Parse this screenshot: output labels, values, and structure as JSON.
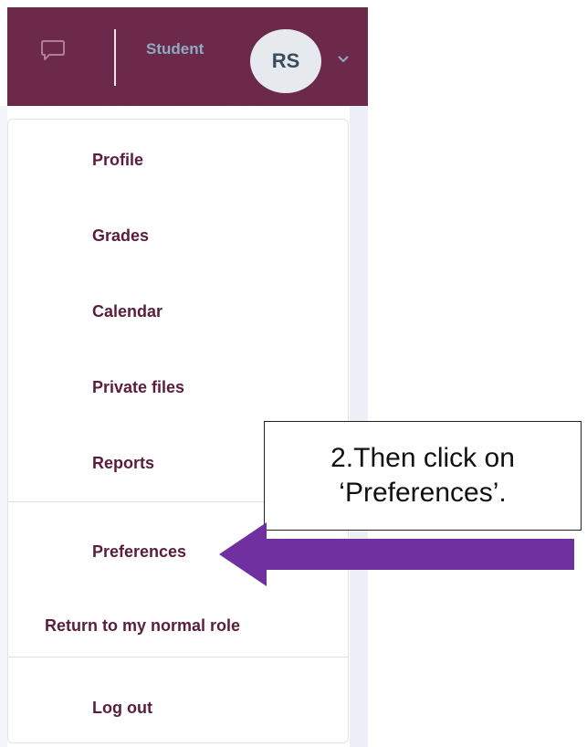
{
  "navbar": {
    "role_label": "Student",
    "avatar_initials": "RS",
    "background_color": "#6e2a4c",
    "icons": [
      "message-icon",
      "chevron-down-icon"
    ]
  },
  "menu": {
    "items": [
      {
        "label": "Profile"
      },
      {
        "label": "Grades"
      },
      {
        "label": "Calendar"
      },
      {
        "label": "Private files"
      },
      {
        "label": "Reports"
      },
      {
        "label": "Preferences"
      },
      {
        "label": "Return to my normal role"
      },
      {
        "label": "Log out"
      }
    ],
    "text_color": "#5b1d3d"
  },
  "annotation": {
    "line1": "2.Then click on",
    "line2": "‘Preferences’.",
    "arrow_color": "#7030a0"
  }
}
